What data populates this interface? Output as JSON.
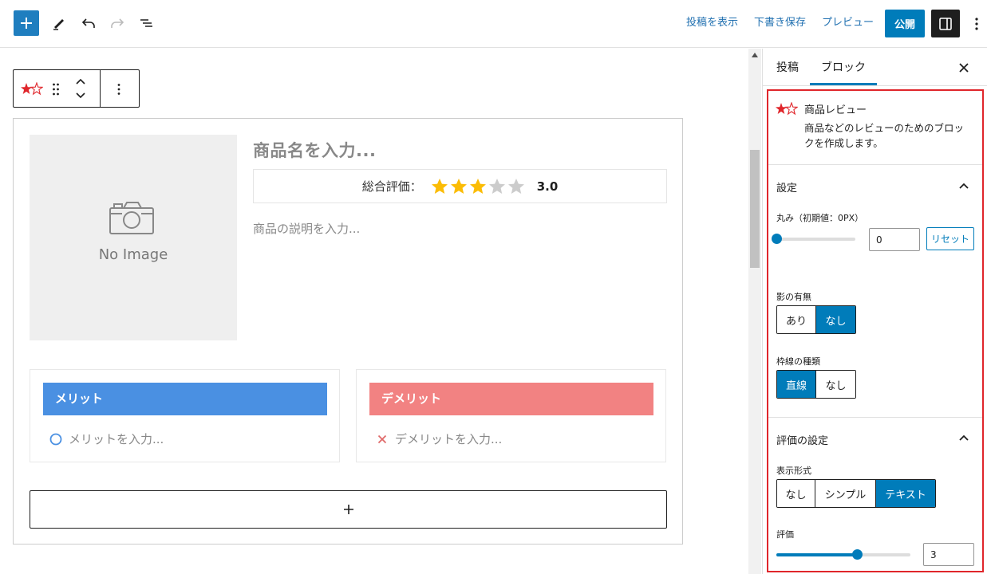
{
  "topbar": {
    "view_post": "投稿を表示",
    "save_draft": "下書き保存",
    "preview": "プレビュー",
    "publish": "公開"
  },
  "review": {
    "product_name_placeholder": "商品名を入力...",
    "rating_label": "総合評価：",
    "rating_value": "3.0",
    "rating": 3,
    "rating_max": 5,
    "description_placeholder": "商品の説明を入力...",
    "no_image": "No Image",
    "merit_title": "メリット",
    "merit_placeholder": "メリットを入力...",
    "demerit_title": "デメリット",
    "demerit_placeholder": "デメリットを入力..."
  },
  "sidebar": {
    "tab_post": "投稿",
    "tab_block": "ブロック",
    "block_name": "商品レビュー",
    "block_description": "商品などのレビューのためのブロックを作成します。",
    "settings_panel": {
      "title": "設定",
      "radius_label": "丸み（初期値：0PX）",
      "radius_value": "0",
      "radius_fraction": 0,
      "reset": "リセット",
      "shadow_label": "影の有無",
      "shadow_options": [
        "あり",
        "なし"
      ],
      "shadow_selected": "なし",
      "border_label": "枠線の種類",
      "border_options": [
        "直線",
        "なし"
      ],
      "border_selected": "直線"
    },
    "rating_panel": {
      "title": "評価の設定",
      "display_label": "表示形式",
      "display_options": [
        "なし",
        "シンプル",
        "テキスト"
      ],
      "display_selected": "テキスト",
      "rating_label": "評価",
      "rating_value": "3",
      "rating_fraction": 0.6
    }
  },
  "colors": {
    "accent": "#007cba",
    "merit": "#4a90e2",
    "demerit": "#f28282",
    "star_on": "#fbbc05",
    "star_off": "#cccccc",
    "highlight": "#e0262b"
  }
}
